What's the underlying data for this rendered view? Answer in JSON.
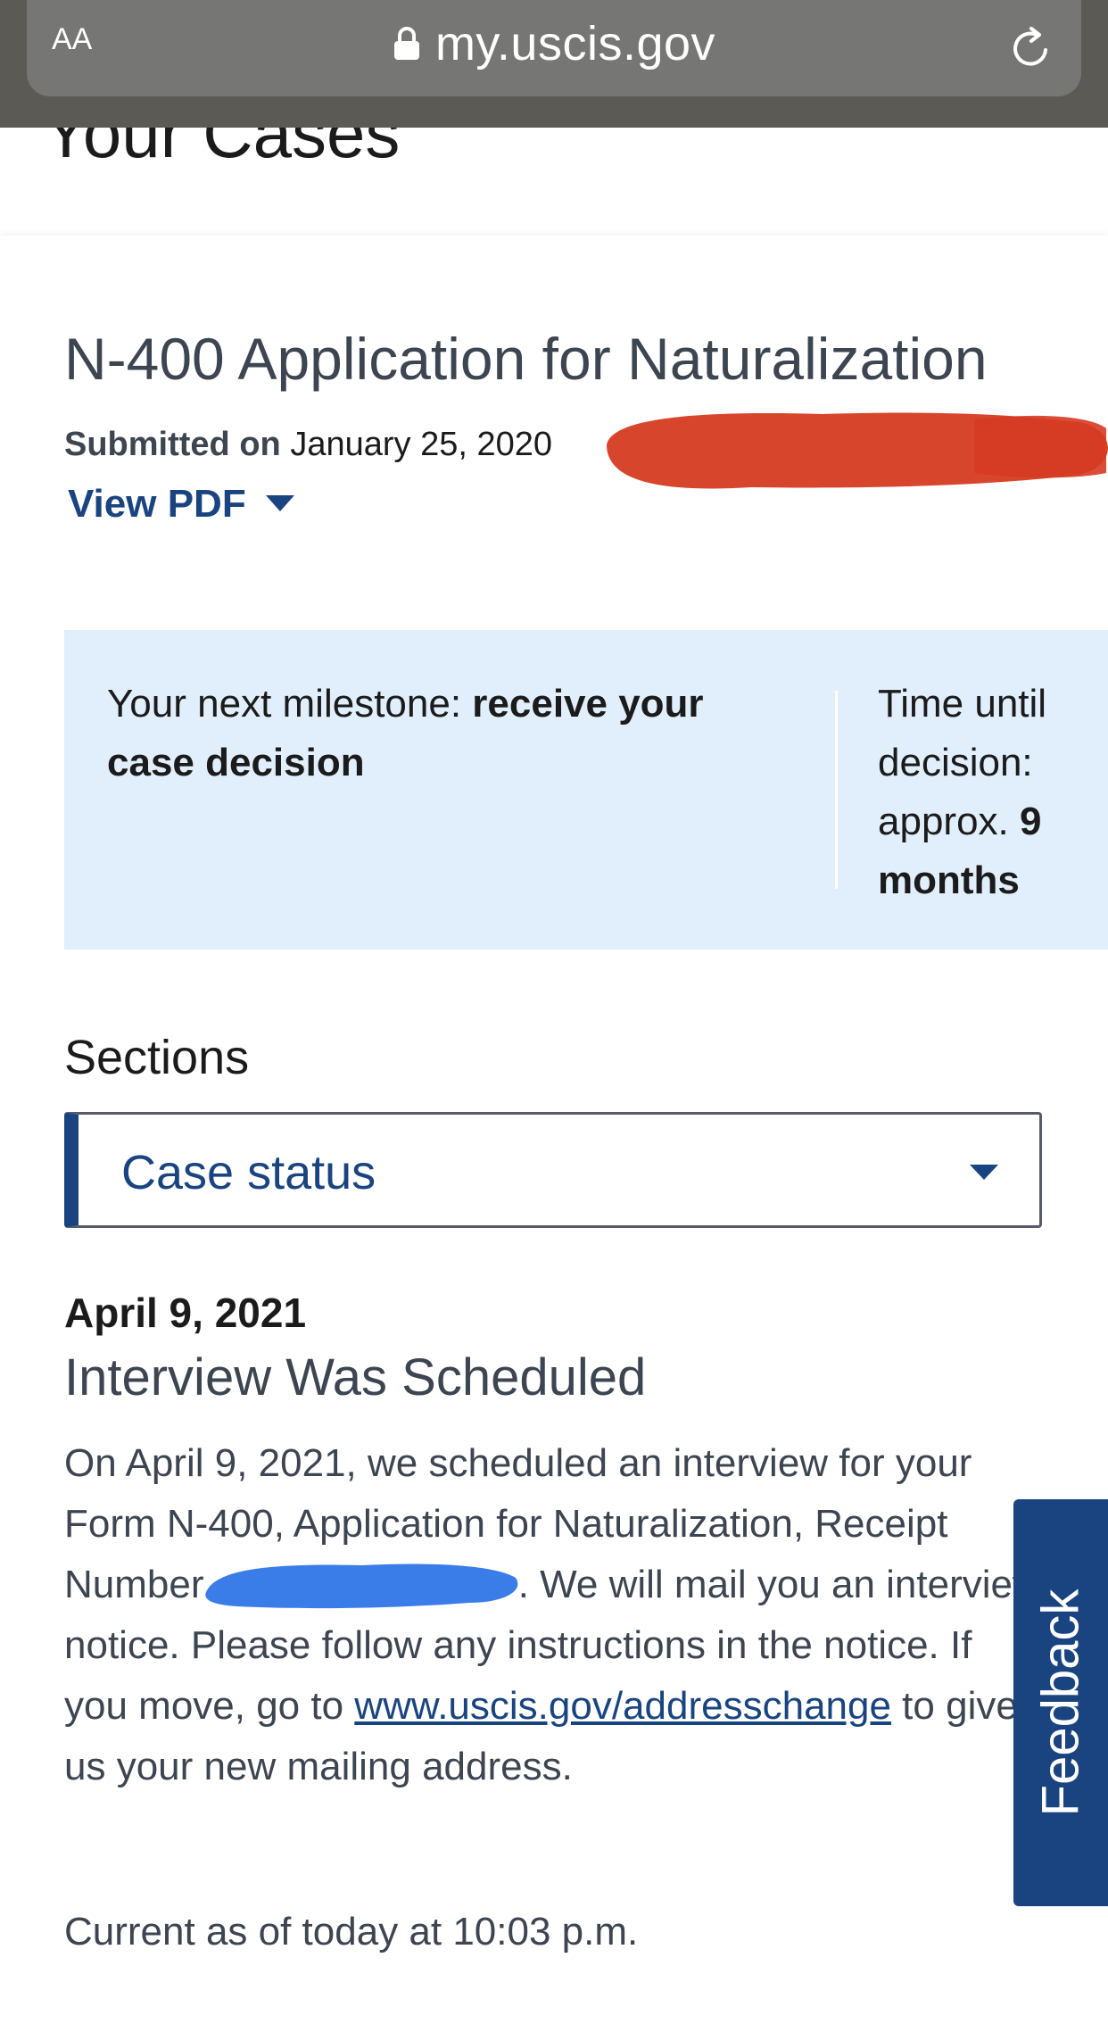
{
  "browser": {
    "text_size_button": "AA",
    "url": "my.uscis.gov",
    "lock_icon": "lock-icon",
    "reload_icon": "reload-icon"
  },
  "page": {
    "title": "Your Cases"
  },
  "case": {
    "form_title": "N-400 Application for Naturalization",
    "submitted_label": "Submitted on",
    "submitted_date": "January 25, 2020",
    "view_pdf_label": "View PDF",
    "milestone": {
      "prefix": "Your next milestone: ",
      "value": "receive your case decision",
      "time_prefix": "Time until decision: approx. ",
      "time_value": "9 months"
    },
    "sections": {
      "label": "Sections",
      "selected": "Case status"
    },
    "status": {
      "date": "April 9, 2021",
      "title": "Interview Was Scheduled",
      "line1": "On April 9, 2021, we scheduled an interview for your",
      "line2": "Form N-400, Application for Naturalization, Receipt",
      "line3a": "Number ",
      "line3b": ". We will mail you an interview",
      "line4": "notice. Please follow any instructions in the notice. If",
      "line5a": "you move, go to ",
      "link": "www.uscis.gov/addresschange",
      "line5b": " to give",
      "line6": "us your new mailing address."
    },
    "current_as_of": "Current as of today at 10:03 p.m."
  },
  "feedback": {
    "label": "Feedback"
  },
  "colors": {
    "primary": "#1a4480",
    "milestone_bg": "#e1eefb",
    "redaction_red": "#d63b22",
    "redaction_blue": "#3b7de8",
    "browser_bar": "#5b5a55"
  }
}
